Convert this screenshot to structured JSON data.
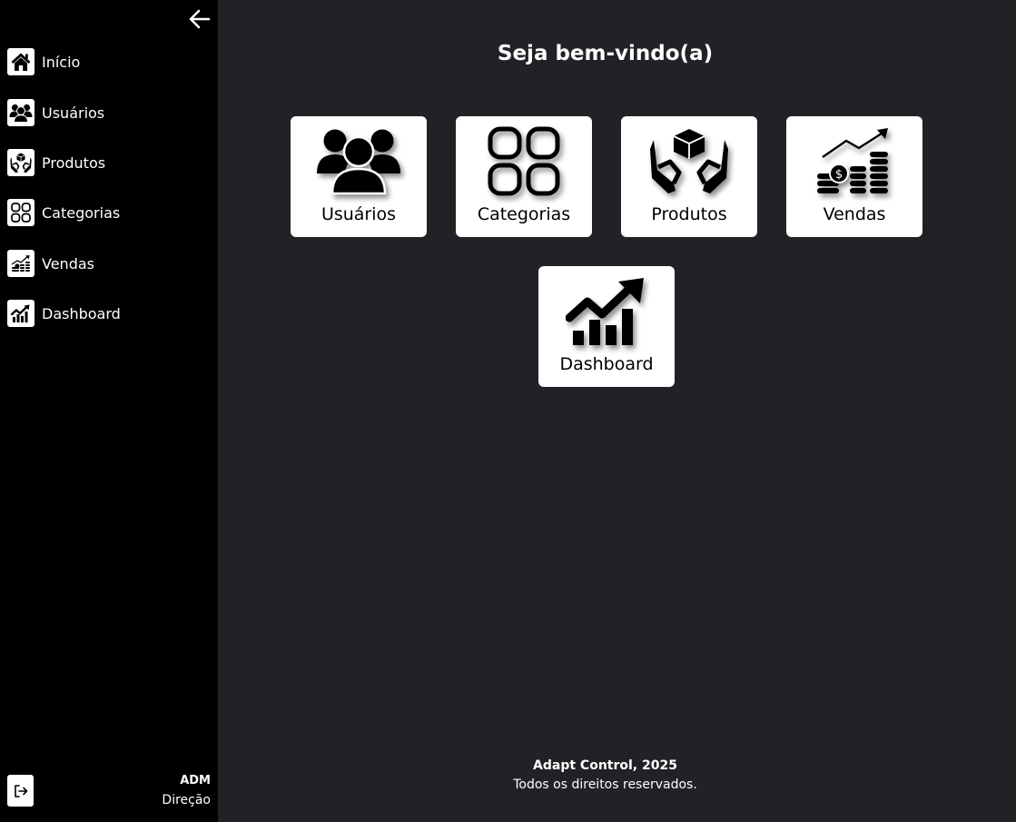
{
  "sidebar": {
    "items": [
      {
        "label": "Início",
        "icon": "home-icon"
      },
      {
        "label": "Usuários",
        "icon": "users-icon"
      },
      {
        "label": "Produtos",
        "icon": "products-icon"
      },
      {
        "label": "Categorias",
        "icon": "categories-icon"
      },
      {
        "label": "Vendas",
        "icon": "sales-icon"
      },
      {
        "label": "Dashboard",
        "icon": "dashboard-icon"
      }
    ],
    "user": {
      "name": "ADM",
      "role": "Direção"
    }
  },
  "main": {
    "welcome": "Seja bem-vindo(a)",
    "cards": [
      {
        "label": "Usuários",
        "icon": "users-icon"
      },
      {
        "label": "Categorias",
        "icon": "categories-icon"
      },
      {
        "label": "Produtos",
        "icon": "products-icon"
      },
      {
        "label": "Vendas",
        "icon": "sales-icon"
      },
      {
        "label": "Dashboard",
        "icon": "dashboard-icon"
      }
    ]
  },
  "footer": {
    "title": "Adapt Control, 2025",
    "rights": "Todos os direitos reservados."
  },
  "colors": {
    "sidebar_bg": "#000000",
    "main_bg": "#222126",
    "card_bg": "#ffffff"
  }
}
